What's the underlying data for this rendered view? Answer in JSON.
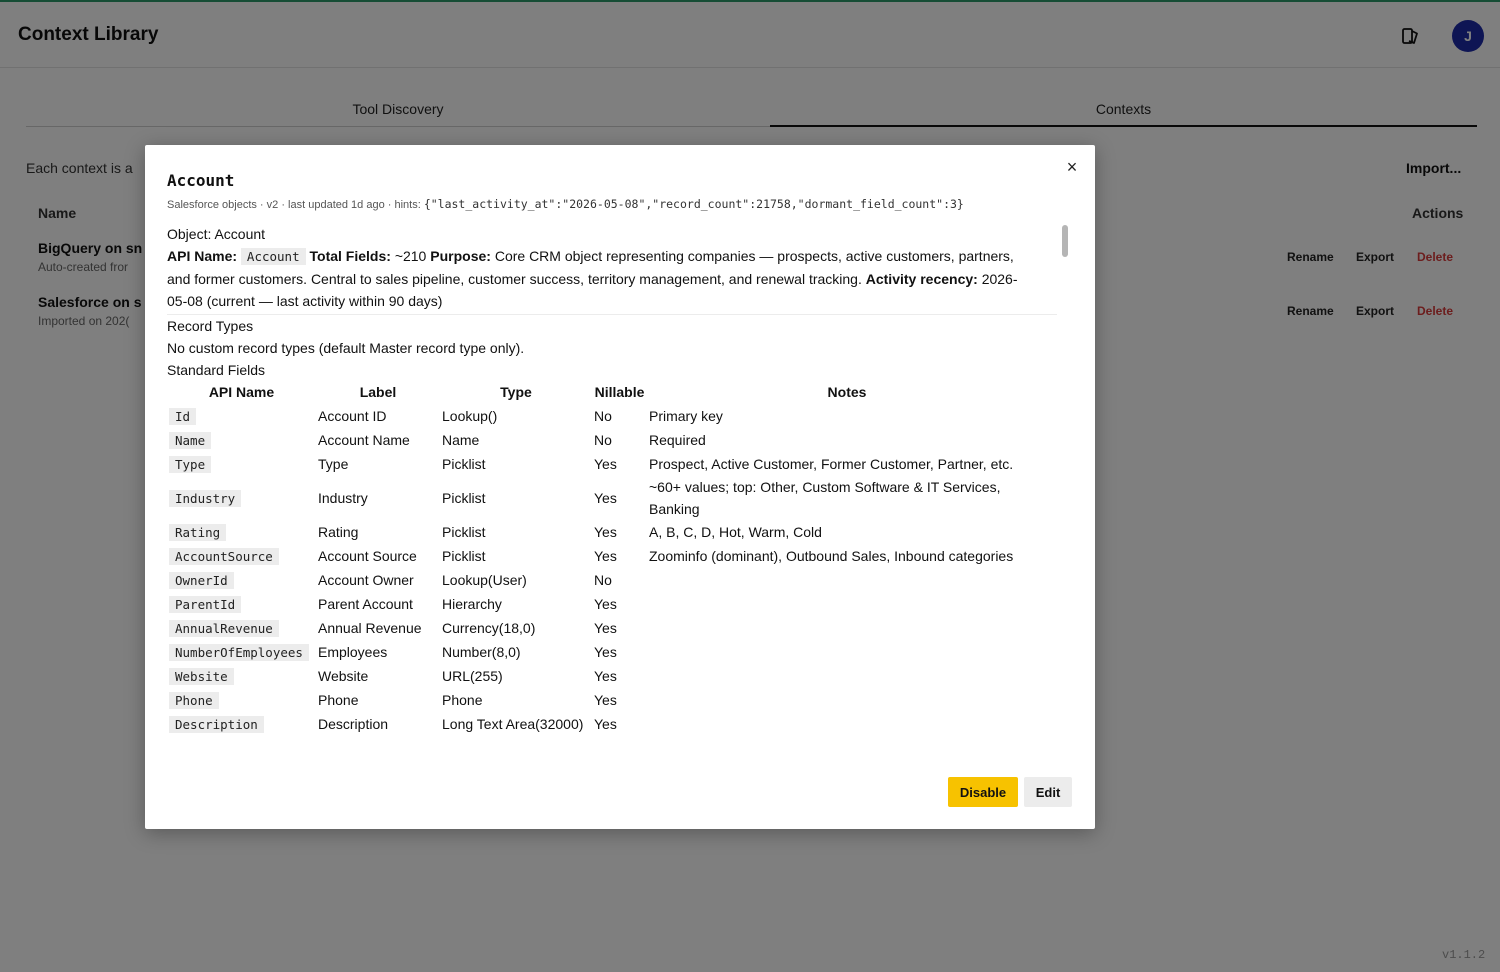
{
  "app": {
    "title": "Context Library",
    "avatar_initial": "J",
    "version": "v1.1.2"
  },
  "tabs": [
    {
      "label": "Tool Discovery"
    },
    {
      "label": "Contexts"
    }
  ],
  "contexts_page": {
    "intro_visible": "Each context is a",
    "import_label": "Import...",
    "col_name": "Name",
    "col_actions": "Actions",
    "rows": [
      {
        "name": "BigQuery on sn",
        "sub": "Auto-created fror",
        "rename": "Rename",
        "export": "Export",
        "delete": "Delete"
      },
      {
        "name": "Salesforce on s",
        "sub": "Imported on 202(",
        "rename": "Rename",
        "export": "Export",
        "delete": "Delete"
      }
    ]
  },
  "modal": {
    "title": "Account",
    "meta_text": "Salesforce objects · v2 · last updated 1d ago · hints: ",
    "meta_hints": "{\"last_activity_at\":\"2026-05-08\",\"record_count\":21758,\"dormant_field_count\":3}",
    "object_line": "Object: Account",
    "api_name_label": "API Name:",
    "api_name_value": "Account",
    "total_fields_label": "Total Fields:",
    "total_fields_value": "~210",
    "purpose_label": "Purpose:",
    "purpose_text": "Core CRM object representing companies — prospects, active customers, partners, and former customers. Central to sales pipeline, customer success, territory management, and renewal tracking.",
    "activity_label": "Activity recency:",
    "activity_text": "2026-05-08 (current — last activity within 90 days)",
    "record_types_heading": "Record Types",
    "record_types_text": "No custom record types (default Master record type only).",
    "standard_fields_heading": "Standard Fields",
    "table": {
      "headers": [
        "API Name",
        "Label",
        "Type",
        "Nillable",
        "Notes"
      ],
      "rows": [
        {
          "api": "Id",
          "label": "Account ID",
          "type": "Lookup()",
          "nillable": "No",
          "notes": "Primary key"
        },
        {
          "api": "Name",
          "label": "Account Name",
          "type": "Name",
          "nillable": "No",
          "notes": "Required"
        },
        {
          "api": "Type",
          "label": "Type",
          "type": "Picklist",
          "nillable": "Yes",
          "notes": "Prospect, Active Customer, Former Customer, Partner, etc."
        },
        {
          "api": "Industry",
          "label": "Industry",
          "type": "Picklist",
          "nillable": "Yes",
          "notes": "~60+ values; top: Other, Custom Software & IT Services, Banking"
        },
        {
          "api": "Rating",
          "label": "Rating",
          "type": "Picklist",
          "nillable": "Yes",
          "notes": "A, B, C, D, Hot, Warm, Cold"
        },
        {
          "api": "AccountSource",
          "label": "Account Source",
          "type": "Picklist",
          "nillable": "Yes",
          "notes": "Zoominfo (dominant), Outbound Sales, Inbound categories"
        },
        {
          "api": "OwnerId",
          "label": "Account Owner",
          "type": "Lookup(User)",
          "nillable": "No",
          "notes": ""
        },
        {
          "api": "ParentId",
          "label": "Parent Account",
          "type": "Hierarchy",
          "nillable": "Yes",
          "notes": ""
        },
        {
          "api": "AnnualRevenue",
          "label": "Annual Revenue",
          "type": "Currency(18,0)",
          "nillable": "Yes",
          "notes": ""
        },
        {
          "api": "NumberOfEmployees",
          "label": "Employees",
          "type": "Number(8,0)",
          "nillable": "Yes",
          "notes": ""
        },
        {
          "api": "Website",
          "label": "Website",
          "type": "URL(255)",
          "nillable": "Yes",
          "notes": ""
        },
        {
          "api": "Phone",
          "label": "Phone",
          "type": "Phone",
          "nillable": "Yes",
          "notes": ""
        },
        {
          "api": "Description",
          "label": "Description",
          "type": "Long Text Area(32000)",
          "nillable": "Yes",
          "notes": ""
        }
      ]
    },
    "disable_label": "Disable",
    "edit_label": "Edit",
    "close_symbol": "×"
  }
}
